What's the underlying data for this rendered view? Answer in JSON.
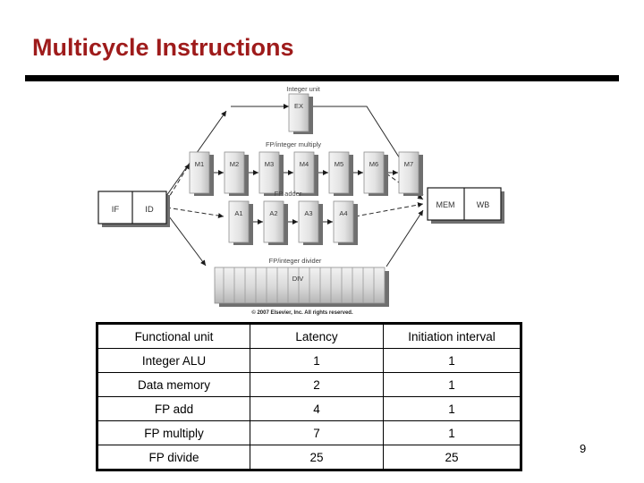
{
  "slide": {
    "title": "Multicycle Instructions",
    "page_number": "9",
    "title_color": "#9E1B1B"
  },
  "figure": {
    "front_end": [
      {
        "id": "if-stage",
        "label": "IF"
      },
      {
        "id": "id-stage",
        "label": "ID"
      }
    ],
    "units": [
      {
        "id": "integer-unit",
        "caption": "Integer unit",
        "stages": [
          "EX"
        ]
      },
      {
        "id": "fp-integer-multiply-unit",
        "caption": "FP/integer multiply",
        "stages": [
          "M1",
          "M2",
          "M3",
          "M4",
          "M5",
          "M6",
          "M7"
        ]
      },
      {
        "id": "fp-adder-unit",
        "caption": "FP adder",
        "stages": [
          "A1",
          "A2",
          "A3",
          "A4"
        ]
      },
      {
        "id": "fp-integer-divider-unit",
        "caption": "FP/integer divider",
        "stages": [
          "DIV"
        ]
      }
    ],
    "back_end": [
      {
        "id": "mem-stage",
        "label": "MEM"
      },
      {
        "id": "wb-stage",
        "label": "WB"
      }
    ],
    "copyright": "© 2007 Elsevier, Inc. All rights reserved."
  },
  "table": {
    "headers": [
      "Functional unit",
      "Latency",
      "Initiation interval"
    ],
    "rows": [
      [
        "Integer ALU",
        "1",
        "1"
      ],
      [
        "Data memory",
        "2",
        "1"
      ],
      [
        "FP add",
        "4",
        "1"
      ],
      [
        "FP multiply",
        "7",
        "1"
      ],
      [
        "FP divide",
        "25",
        "25"
      ]
    ]
  }
}
